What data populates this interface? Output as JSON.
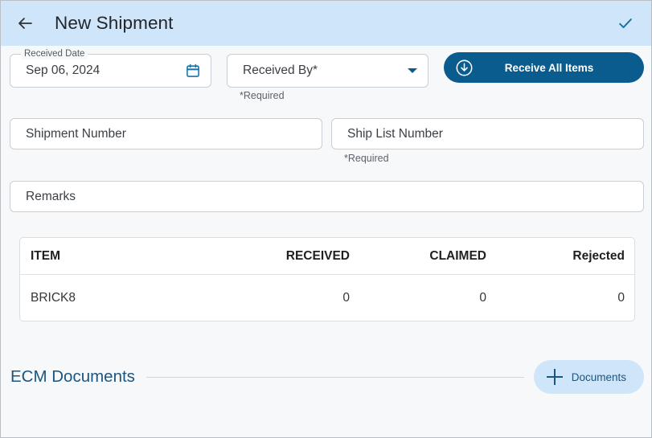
{
  "appbar": {
    "back_icon": "arrow-left-icon",
    "title": "New Shipment",
    "confirm_icon": "checkmark-icon",
    "background_color": "#cfe5fa"
  },
  "form": {
    "received_date": {
      "label": "Received Date",
      "value": "Sep 06, 2024",
      "icon": "calendar-icon"
    },
    "received_by": {
      "placeholder": "Received By*",
      "value": "",
      "caret_icon": "chevron-down-icon",
      "required_note": "*Required"
    },
    "receive_all": {
      "label": "Receive All Items",
      "icon": "arrow-down-circle-icon",
      "color": "#0b5c8e"
    },
    "shipment_number": {
      "placeholder": "Shipment Number",
      "value": ""
    },
    "ship_list_number": {
      "placeholder": "Ship List Number",
      "value": "",
      "required_note": "*Required"
    },
    "remarks": {
      "placeholder": "Remarks",
      "value": ""
    }
  },
  "items_table": {
    "columns": [
      "ITEM",
      "RECEIVED",
      "CLAIMED",
      "Rejected"
    ],
    "rows": [
      {
        "item": "BRICK8",
        "received": "0",
        "claimed": "0",
        "rejected": "0"
      }
    ]
  },
  "ecm": {
    "title": "ECM Documents",
    "title_color": "#1a5680",
    "documents_button": {
      "label": "Documents",
      "icon": "plus-icon",
      "background_color": "#cfe5fa"
    }
  }
}
